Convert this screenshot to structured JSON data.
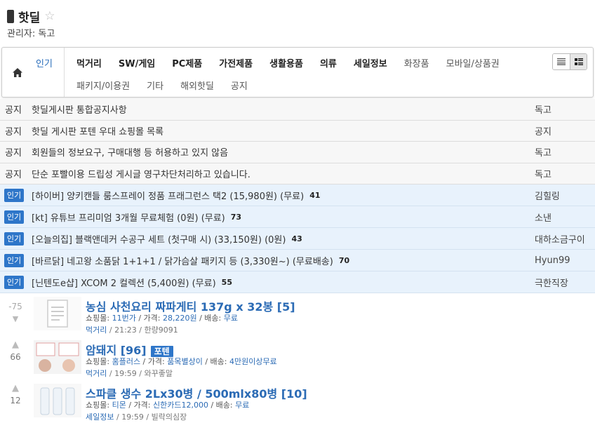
{
  "board": {
    "title": "핫딜",
    "admin": "관리자: 독고"
  },
  "categories": {
    "popular": "인기",
    "row1": [
      "먹거리",
      "SW/게임",
      "PC제품",
      "가전제품",
      "생활용품",
      "의류",
      "세일정보",
      "화장품",
      "모바일/상품권"
    ],
    "row2": [
      "패키지/이용권",
      "기타",
      "해외핫딜",
      "공지"
    ]
  },
  "notices": [
    {
      "tag": "공지",
      "title": "핫딜게시판 통합공지사항",
      "author": "독고"
    },
    {
      "tag": "공지",
      "title": "핫딜 게시판 포텐 우대 쇼핑몰 목록",
      "author": "공지"
    },
    {
      "tag": "공지",
      "title": "회원들의 정보요구, 구매대행 등 허용하고 있지 않음",
      "author": "독고"
    },
    {
      "tag": "공지",
      "title": "단순 포빨이용 드립성 게시글 영구차단처리하고 있습니다.",
      "author": "독고"
    }
  ],
  "hot": [
    {
      "badge": "인기",
      "title": "[하이버] 양키캔들 룸스프레이 정품 프래그런스 택2 (15,980원) (무료)",
      "count": "41",
      "author": "김힐링"
    },
    {
      "badge": "인기",
      "title": "[kt] 유튜브 프리미엄 3개월 무료체험 (0원) (무료)",
      "count": "73",
      "author": "소낸"
    },
    {
      "badge": "인기",
      "title": "[오늘의집] 블랙앤데커 수공구 세트 (첫구매 시) (33,150원) (0원)",
      "count": "43",
      "author": "대하소금구이"
    },
    {
      "badge": "인기",
      "title": "[바르닭] 네고왕 소품닭 1+1+1 / 닭가슴살 패키지 등 (3,330원~) (무료배송)",
      "count": "70",
      "author": "Hyun99"
    },
    {
      "badge": "인기",
      "title": "[닌텐도e샵] XCOM 2 컬렉션 (5,400원) (무료)",
      "count": "55",
      "author": "극한직장"
    }
  ],
  "deals": [
    {
      "votes": "-75",
      "title": "농심 사천요리 짜파게티 137g x 32봉 [5]",
      "badge": "",
      "shop_label": "쇼핑몰:",
      "shop": "11번가",
      "price_label": "가격:",
      "price": "28,220원",
      "ship_label": "배송:",
      "ship": "무료",
      "category": "먹거리",
      "time": "21:23",
      "user": "한량9091"
    },
    {
      "votes": "66",
      "title": "암돼지 [96]",
      "badge": "포텐",
      "shop_label": "쇼핑몰:",
      "shop": "홈플러스",
      "price_label": "가격:",
      "price": "품목별상이",
      "ship_label": "배송:",
      "ship": "4만원이상무료",
      "category": "먹거리",
      "time": "19:59",
      "user": "와꾸좋말"
    },
    {
      "votes": "12",
      "title": "스파클 생수 2Lx30병 / 500mlx80병 [10]",
      "badge": "",
      "shop_label": "쇼핑몰:",
      "shop": "티몬",
      "price_label": "가격:",
      "price": "신한카드12,000",
      "ship_label": "배송:",
      "ship": "무료",
      "category": "세일정보",
      "time": "19:59",
      "user": "빌락의심장"
    }
  ],
  "colors": {
    "accent": "#2e76c9",
    "link": "#2b6bb5",
    "hot_bg": "#e8f2fc"
  }
}
